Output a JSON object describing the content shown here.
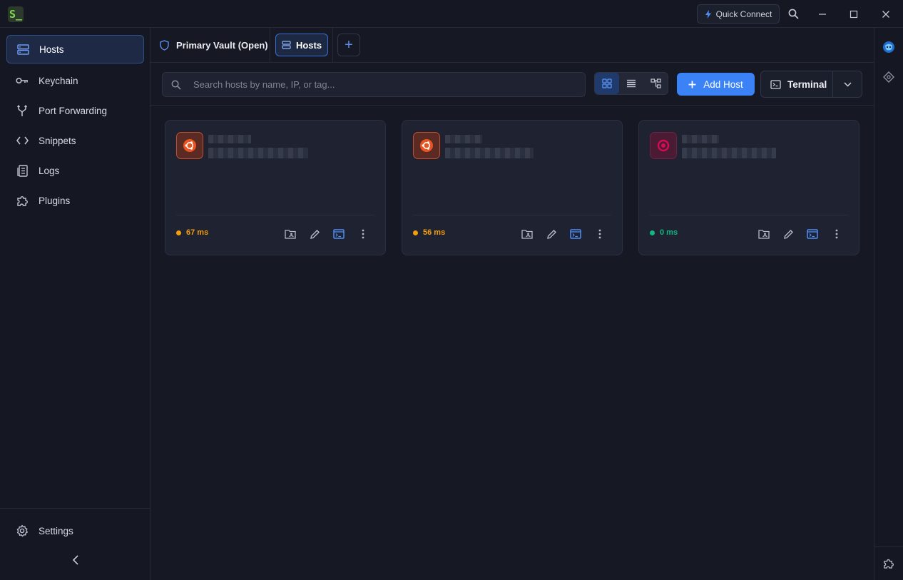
{
  "titlebar": {
    "logo_text": "S_",
    "quick_connect_label": "Quick Connect"
  },
  "sidebar": {
    "items": [
      {
        "label": "Hosts",
        "icon": "server-icon",
        "active": true
      },
      {
        "label": "Keychain",
        "icon": "key-icon"
      },
      {
        "label": "Port Forwarding",
        "icon": "fork-icon"
      },
      {
        "label": "Snippets",
        "icon": "code-icon"
      },
      {
        "label": "Logs",
        "icon": "document-icon"
      },
      {
        "label": "Plugins",
        "icon": "puzzle-icon"
      }
    ],
    "settings_label": "Settings"
  },
  "tabs": {
    "vault_label": "Primary Vault (Open)",
    "hosts_label": "Hosts",
    "add_label": "+"
  },
  "toolbar": {
    "search_placeholder": "Search hosts by name, IP, or tag...",
    "view_modes": [
      "grid",
      "list",
      "tree"
    ],
    "active_view": "grid",
    "add_host_label": "Add Host",
    "terminal_label": "Terminal"
  },
  "hosts": [
    {
      "os": "ubuntu",
      "latency": "67 ms",
      "status_color": "#f59e0b"
    },
    {
      "os": "ubuntu",
      "latency": "56 ms",
      "status_color": "#f59e0b"
    },
    {
      "os": "debian",
      "latency": "0 ms",
      "status_color": "#10b981"
    }
  ],
  "colors": {
    "accent": "#3b82f6",
    "ubuntu": "#e95420",
    "debian": "#d70a53",
    "warning": "#f59e0b",
    "success": "#10b981"
  }
}
